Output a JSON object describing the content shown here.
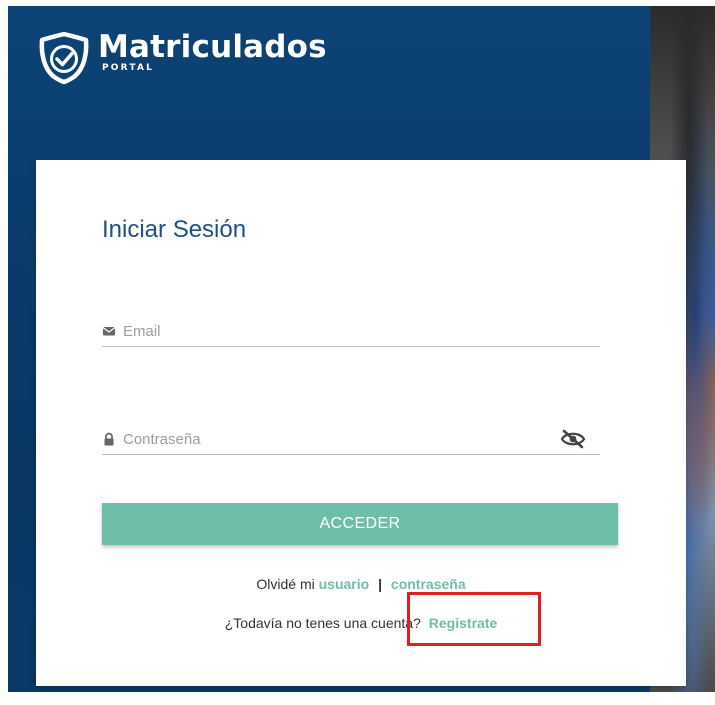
{
  "brand": {
    "name": "Matriculados",
    "sub": "PORTAL",
    "logo_icon": "shield-check-icon"
  },
  "login": {
    "title": "Iniciar Sesión",
    "email": {
      "placeholder": "Email",
      "icon": "envelope-icon"
    },
    "password": {
      "placeholder": "Contraseña",
      "icon": "lock-icon",
      "toggle_icon": "eye-off-icon"
    },
    "submit_label": "ACCEDER",
    "forgot_prefix": "Olvidé mi",
    "forgot_user": "usuario",
    "forgot_separator": "|",
    "forgot_password": "contraseña",
    "register_prompt": "¿Todavía no tenes una cuenta?",
    "register_link": "Registrate"
  },
  "colors": {
    "primary": "#6fbea9",
    "title": "#1f4f86",
    "background": "#0b3d6f",
    "highlight": "#e01f1f"
  }
}
